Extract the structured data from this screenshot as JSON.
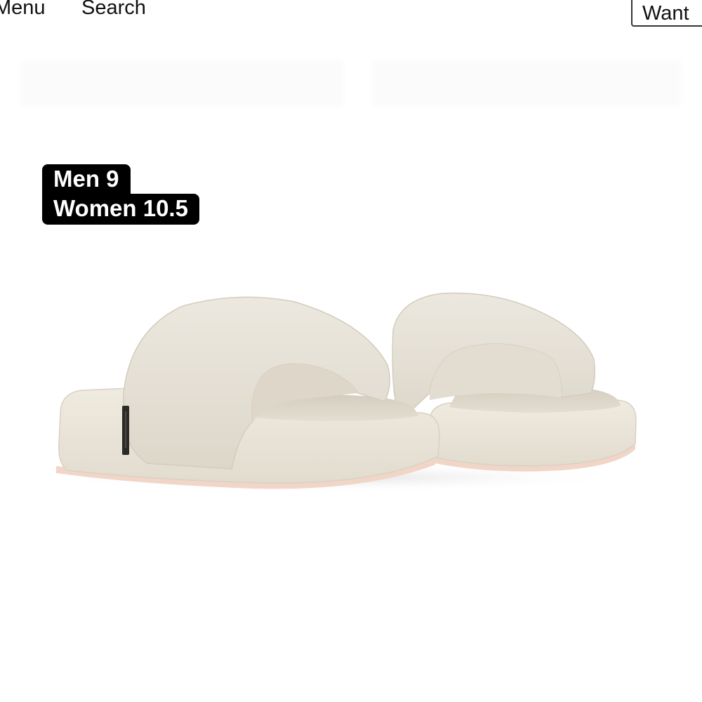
{
  "header": {
    "menu_label": "Menu",
    "search_label": "Search",
    "want_label": "Want"
  },
  "product": {
    "image_icon": "platform-slide-sandals",
    "size_tag": {
      "men": "Men 9",
      "women": "Women 10.5"
    },
    "colors": {
      "upper": "#e6e1d6",
      "sole": "#efe9dd",
      "outsole": "#f1d6c8",
      "tag": "#000000"
    }
  }
}
